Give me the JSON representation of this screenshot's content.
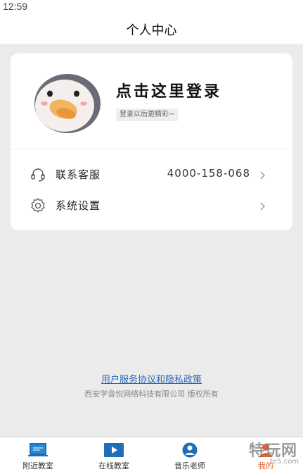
{
  "status_bar": {
    "time": "12:59"
  },
  "header": {
    "title": "个人中心"
  },
  "profile": {
    "login_title": "点击这里登录",
    "login_hint": "登录以后更精彩~"
  },
  "menu": {
    "service": {
      "label": "联系客服",
      "phone": "4000-158-068",
      "icon": "headset-icon"
    },
    "settings": {
      "label": "系统设置",
      "icon": "gear-icon"
    }
  },
  "footer": {
    "agreement_link": "用户服务协议和隐私政策",
    "copyright": "西安学音悦网络科技有限公司 版权所有"
  },
  "tabbar": {
    "tabs": [
      {
        "label": "附近教室",
        "icon": "classroom-board-icon"
      },
      {
        "label": "在线教室",
        "icon": "video-play-icon"
      },
      {
        "label": "音乐老师",
        "icon": "teacher-icon"
      },
      {
        "label": "我的",
        "icon": "profile-icon",
        "active": true
      }
    ]
  },
  "watermark": {
    "text": "特玩网",
    "sub": "te5.com"
  },
  "colors": {
    "accent": "#e8632a",
    "link": "#2a66b8",
    "background": "#ebebeb"
  }
}
